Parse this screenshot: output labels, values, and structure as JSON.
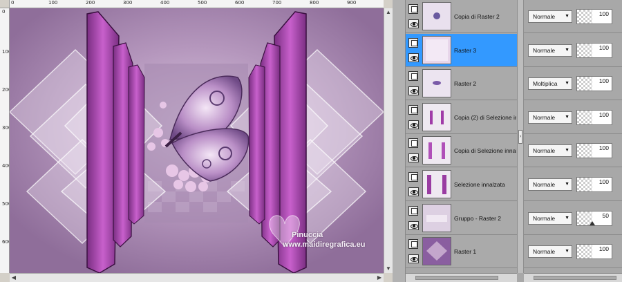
{
  "ruler": {
    "h_labels": [
      "0",
      "100",
      "200",
      "300",
      "400",
      "500",
      "600",
      "700",
      "800",
      "900"
    ],
    "v_labels": [
      "0",
      "100",
      "200",
      "300",
      "400",
      "500",
      "600"
    ]
  },
  "watermark": {
    "name": "Pinuccia",
    "site": "www.maidiregrafica.eu"
  },
  "layers": [
    {
      "name": "Copia di Raster 2",
      "blend": "Normale",
      "opacity": "100",
      "selected": false
    },
    {
      "name": "Raster 3",
      "blend": "Normale",
      "opacity": "100",
      "selected": true
    },
    {
      "name": "Raster 2",
      "blend": "Moltiplica",
      "opacity": "100",
      "selected": false
    },
    {
      "name": "Copia (2) di Selezione in",
      "blend": "Normale",
      "opacity": "100",
      "selected": false
    },
    {
      "name": "Copia di Selezione innal",
      "blend": "Normale",
      "opacity": "100",
      "selected": false
    },
    {
      "name": "Selezione innalzata",
      "blend": "Normale",
      "opacity": "100",
      "selected": false
    },
    {
      "name": "Gruppo - Raster 2",
      "blend": "Normale",
      "opacity": "50",
      "selected": false
    },
    {
      "name": "Raster 1",
      "blend": "Normale",
      "opacity": "100",
      "selected": false
    }
  ],
  "colors": {
    "selected_row": "#3399ff",
    "accent_magenta": "#c050c8"
  }
}
